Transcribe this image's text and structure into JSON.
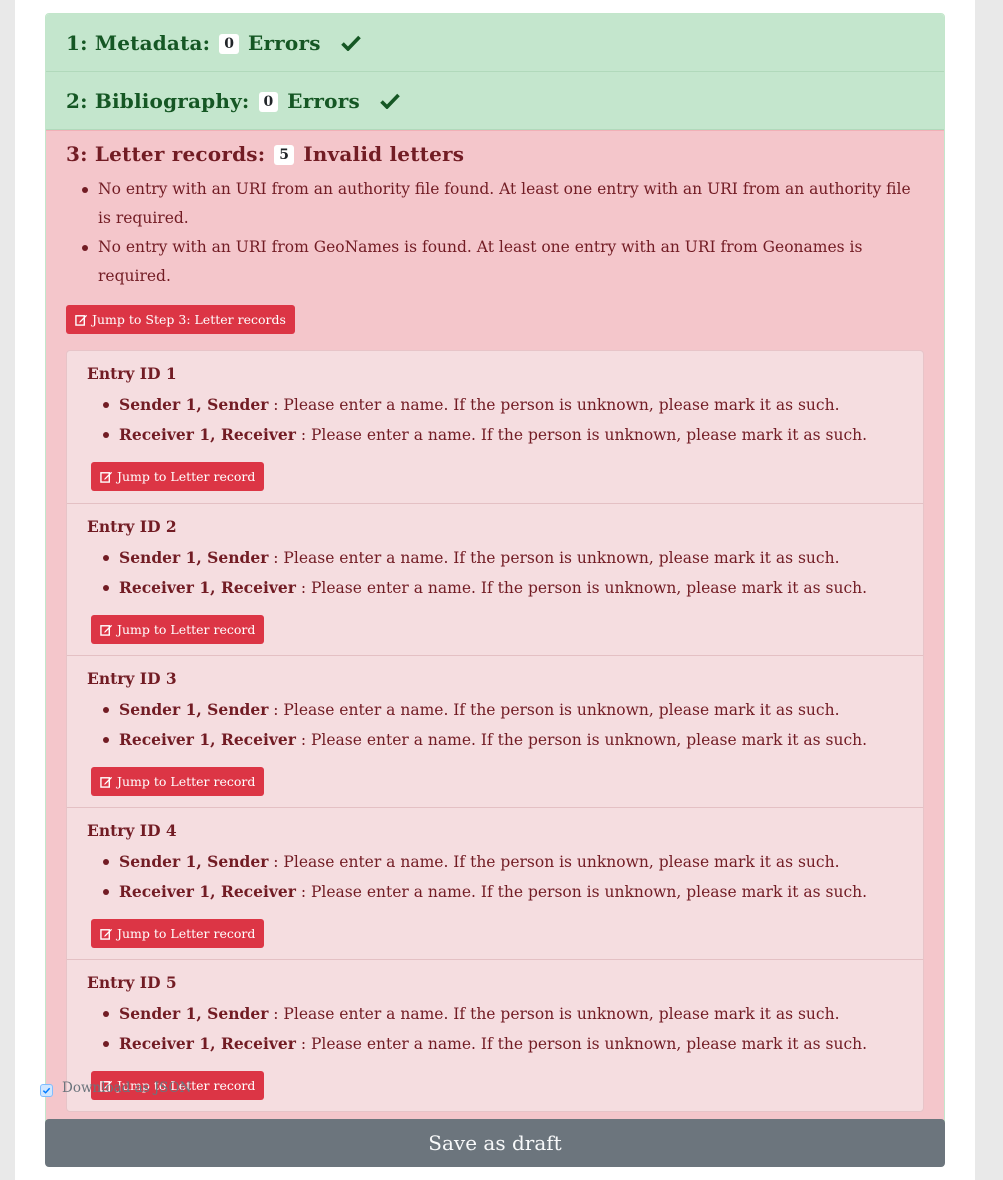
{
  "steps": [
    {
      "title": "1: Metadata:",
      "count": "0",
      "suffix": "Errors"
    },
    {
      "title": "2: Bibliography:",
      "count": "0",
      "suffix": "Errors"
    }
  ],
  "letter_step": {
    "title": "3: Letter records:",
    "count": "5",
    "suffix": "Invalid letters",
    "messages": [
      "No entry with an URI from an authority file found. At least one entry with an URI from an authority file is required.",
      "No entry with an URI from GeoNames is found. At least one entry with an URI from Geonames is required."
    ],
    "jump_label": "Jump to Step 3: Letter records"
  },
  "entries": [
    {
      "title": "Entry ID 1",
      "issues": [
        {
          "field": "Sender 1, Sender",
          "text": " : Please enter a name. If the person is unknown, please mark it as such."
        },
        {
          "field": "Receiver 1, Receiver",
          "text": " : Please enter a name. If the person is unknown, please mark it as such."
        }
      ],
      "button": "Jump to Letter record"
    },
    {
      "title": "Entry ID 2",
      "issues": [
        {
          "field": "Sender 1, Sender",
          "text": " : Please enter a name. If the person is unknown, please mark it as such."
        },
        {
          "field": "Receiver 1, Receiver",
          "text": " : Please enter a name. If the person is unknown, please mark it as such."
        }
      ],
      "button": "Jump to Letter record"
    },
    {
      "title": "Entry ID 3",
      "issues": [
        {
          "field": "Sender 1, Sender",
          "text": " : Please enter a name. If the person is unknown, please mark it as such."
        },
        {
          "field": "Receiver 1, Receiver",
          "text": " : Please enter a name. If the person is unknown, please mark it as such."
        }
      ],
      "button": "Jump to Letter record"
    },
    {
      "title": "Entry ID 4",
      "issues": [
        {
          "field": "Sender 1, Sender",
          "text": " : Please enter a name. If the person is unknown, please mark it as such."
        },
        {
          "field": "Receiver 1, Receiver",
          "text": " : Please enter a name. If the person is unknown, please mark it as such."
        }
      ],
      "button": "Jump to Letter record"
    },
    {
      "title": "Entry ID 5",
      "issues": [
        {
          "field": "Sender 1, Sender",
          "text": " : Please enter a name. If the person is unknown, please mark it as such."
        },
        {
          "field": "Receiver 1, Receiver",
          "text": " : Please enter a name. If the person is unknown, please mark it as such."
        }
      ],
      "button": "Jump to Letter record"
    }
  ],
  "download_json": {
    "label": "Download as JSON",
    "checked": true
  },
  "save_button": "Save as draft",
  "colors": {
    "success_bg": "#c4e6cd",
    "danger_bg": "#f4c6cb",
    "danger_button": "#dc3545",
    "secondary_button": "#6c757d"
  },
  "icons": {
    "step_ok": "check-icon",
    "jump": "edit-icon",
    "checkbox": "checkmark-icon"
  }
}
